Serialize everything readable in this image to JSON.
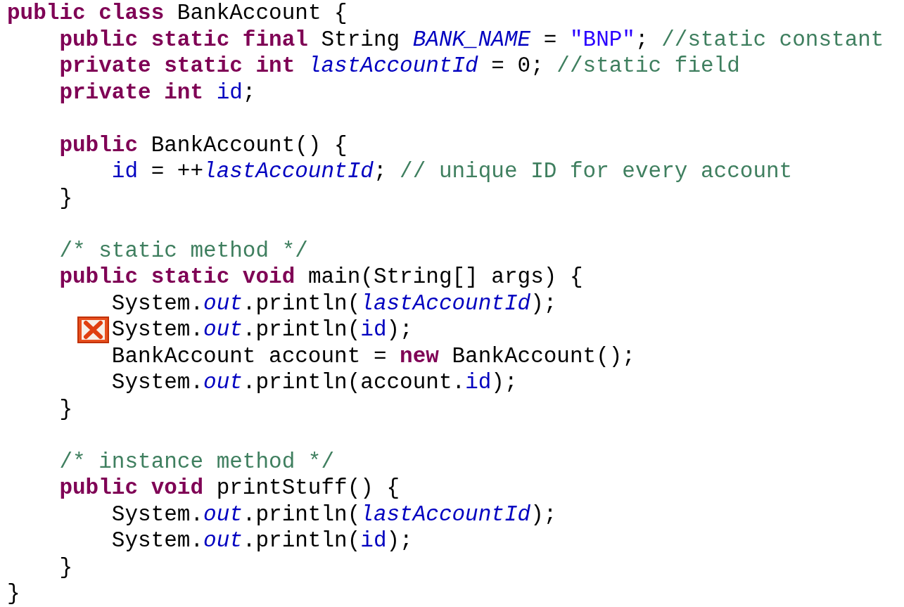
{
  "editor": {
    "lines": [
      {
        "kind": "code",
        "tokens": [
          {
            "kind": "keyword",
            "text": "public class"
          },
          {
            "kind": "plain",
            "text": " BankAccount {"
          }
        ]
      },
      {
        "kind": "code",
        "tokens": [
          {
            "kind": "keyword",
            "text": "    public static final"
          },
          {
            "kind": "plain",
            "text": " String "
          },
          {
            "kind": "static",
            "text": "BANK_NAME"
          },
          {
            "kind": "plain",
            "text": " = "
          },
          {
            "kind": "string",
            "text": "\"BNP\""
          },
          {
            "kind": "plain",
            "text": "; "
          },
          {
            "kind": "comment",
            "text": "//static constant"
          }
        ]
      },
      {
        "kind": "code",
        "tokens": [
          {
            "kind": "keyword",
            "text": "    private static int"
          },
          {
            "kind": "static",
            "text": " lastAccountId"
          },
          {
            "kind": "plain",
            "text": " = 0; "
          },
          {
            "kind": "comment",
            "text": "//static field"
          }
        ]
      },
      {
        "kind": "code",
        "tokens": [
          {
            "kind": "keyword",
            "text": "    private int"
          },
          {
            "kind": "field",
            "text": " id"
          },
          {
            "kind": "plain",
            "text": ";"
          }
        ]
      },
      {
        "kind": "blank"
      },
      {
        "kind": "code",
        "tokens": [
          {
            "kind": "keyword",
            "text": "    public"
          },
          {
            "kind": "plain",
            "text": " BankAccount() {"
          }
        ]
      },
      {
        "kind": "code",
        "tokens": [
          {
            "kind": "field",
            "text": "        id"
          },
          {
            "kind": "plain",
            "text": " = ++"
          },
          {
            "kind": "static",
            "text": "lastAccountId"
          },
          {
            "kind": "plain",
            "text": "; "
          },
          {
            "kind": "comment",
            "text": "// unique ID for every account"
          }
        ]
      },
      {
        "kind": "code",
        "tokens": [
          {
            "kind": "plain",
            "text": "    }"
          }
        ]
      },
      {
        "kind": "blank"
      },
      {
        "kind": "code",
        "tokens": [
          {
            "kind": "comment",
            "text": "    /* static method */"
          }
        ]
      },
      {
        "kind": "code",
        "tokens": [
          {
            "kind": "keyword",
            "text": "    public static void"
          },
          {
            "kind": "plain",
            "text": " main(String[] args) {"
          }
        ]
      },
      {
        "kind": "code",
        "tokens": [
          {
            "kind": "plain",
            "text": "        System."
          },
          {
            "kind": "static",
            "text": "out"
          },
          {
            "kind": "plain",
            "text": ".println("
          },
          {
            "kind": "static",
            "text": "lastAccountId"
          },
          {
            "kind": "plain",
            "text": ");"
          }
        ]
      },
      {
        "kind": "code",
        "error": true,
        "tokens": [
          {
            "kind": "plain",
            "text": "        System."
          },
          {
            "kind": "static",
            "text": "out"
          },
          {
            "kind": "plain",
            "text": ".println("
          },
          {
            "kind": "field",
            "text": "id"
          },
          {
            "kind": "plain",
            "text": ");"
          }
        ]
      },
      {
        "kind": "code",
        "tokens": [
          {
            "kind": "plain",
            "text": "        BankAccount account = "
          },
          {
            "kind": "keyword",
            "text": "new"
          },
          {
            "kind": "plain",
            "text": " BankAccount();"
          }
        ]
      },
      {
        "kind": "code",
        "tokens": [
          {
            "kind": "plain",
            "text": "        System."
          },
          {
            "kind": "static",
            "text": "out"
          },
          {
            "kind": "plain",
            "text": ".println(account."
          },
          {
            "kind": "field",
            "text": "id"
          },
          {
            "kind": "plain",
            "text": ");"
          }
        ]
      },
      {
        "kind": "code",
        "tokens": [
          {
            "kind": "plain",
            "text": "    }"
          }
        ]
      },
      {
        "kind": "blank"
      },
      {
        "kind": "code",
        "tokens": [
          {
            "kind": "comment",
            "text": "    /* instance method */"
          }
        ]
      },
      {
        "kind": "code",
        "tokens": [
          {
            "kind": "keyword",
            "text": "    public void"
          },
          {
            "kind": "plain",
            "text": " printStuff() {"
          }
        ]
      },
      {
        "kind": "code",
        "tokens": [
          {
            "kind": "plain",
            "text": "        System."
          },
          {
            "kind": "static",
            "text": "out"
          },
          {
            "kind": "plain",
            "text": ".println("
          },
          {
            "kind": "static",
            "text": "lastAccountId"
          },
          {
            "kind": "plain",
            "text": ");"
          }
        ]
      },
      {
        "kind": "code",
        "tokens": [
          {
            "kind": "plain",
            "text": "        System."
          },
          {
            "kind": "static",
            "text": "out"
          },
          {
            "kind": "plain",
            "text": ".println("
          },
          {
            "kind": "field",
            "text": "id"
          },
          {
            "kind": "plain",
            "text": ");"
          }
        ]
      },
      {
        "kind": "code",
        "tokens": [
          {
            "kind": "plain",
            "text": "    }"
          }
        ]
      },
      {
        "kind": "code",
        "tokens": [
          {
            "kind": "plain",
            "text": "}"
          }
        ]
      }
    ]
  }
}
